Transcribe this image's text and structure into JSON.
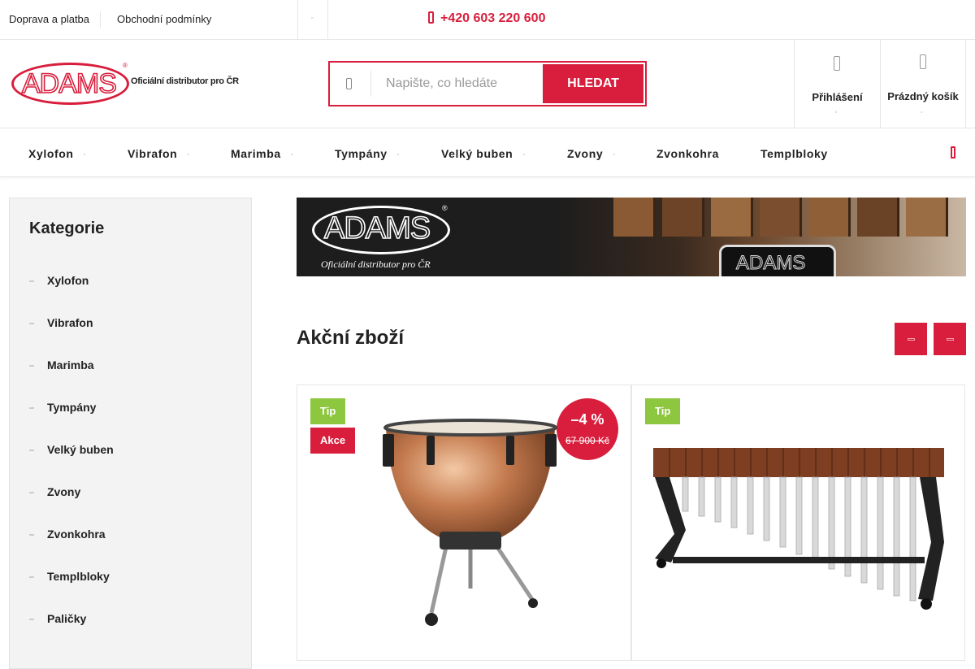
{
  "topbar": {
    "links": [
      "Doprava a platba",
      "Obchodní podmínky"
    ],
    "phone": "+420 603 220 600"
  },
  "header": {
    "logo_mark": "ADAMS",
    "logo_tagline": "Oficiální distributor pro ČR",
    "search": {
      "placeholder": "Napište, co hledáte",
      "button": "HLEDAT"
    },
    "login_label": "Přihlášení",
    "cart_label": "Prázdný košík"
  },
  "nav": {
    "items": [
      {
        "label": "Xylofon",
        "has_dropdown": true
      },
      {
        "label": "Vibrafon",
        "has_dropdown": true
      },
      {
        "label": "Marimba",
        "has_dropdown": true
      },
      {
        "label": "Tympány",
        "has_dropdown": true
      },
      {
        "label": "Velký buben",
        "has_dropdown": true
      },
      {
        "label": "Zvony",
        "has_dropdown": true
      },
      {
        "label": "Zvonkohra",
        "has_dropdown": false
      },
      {
        "label": "Templbloky",
        "has_dropdown": false
      }
    ]
  },
  "sidebar": {
    "title": "Kategorie",
    "items": [
      "Xylofon",
      "Vibrafon",
      "Marimba",
      "Tympány",
      "Velký buben",
      "Zvony",
      "Zvonkohra",
      "Templbloky",
      "Paličky"
    ]
  },
  "banner": {
    "logo_mark": "ADAMS",
    "tagline": "Oficiální distributor pro ČR"
  },
  "section": {
    "title": "Akční zboží"
  },
  "products": [
    {
      "flags": [
        "Tip",
        "Akce"
      ],
      "discount": "–4 %",
      "old_price": "67 900 Kč",
      "image": "timpani-drum"
    },
    {
      "flags": [
        "Tip"
      ],
      "image": "marimba"
    }
  ],
  "colors": {
    "accent": "#d81e3c",
    "tip_flag": "#8dc63f",
    "sidebar_bg": "#f3f3f3"
  }
}
